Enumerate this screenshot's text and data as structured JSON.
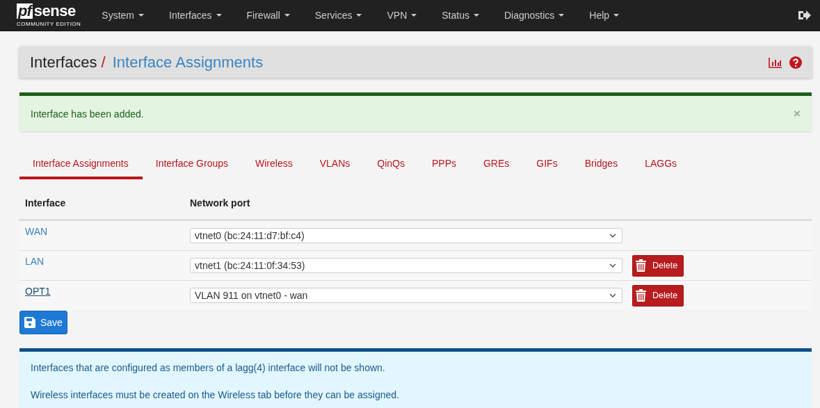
{
  "navbar": {
    "logo": {
      "mark": "pf",
      "word": "sense",
      "edition": "COMMUNITY EDITION"
    },
    "menus": [
      {
        "label": "System"
      },
      {
        "label": "Interfaces"
      },
      {
        "label": "Firewall"
      },
      {
        "label": "Services"
      },
      {
        "label": "VPN"
      },
      {
        "label": "Status"
      },
      {
        "label": "Diagnostics"
      },
      {
        "label": "Help"
      }
    ]
  },
  "page_header": {
    "section": "Interfaces",
    "separator": "/",
    "title": "Interface Assignments"
  },
  "alert": {
    "kind": "success",
    "message": "Interface has been added.",
    "close": "×"
  },
  "tabs": [
    {
      "label": "Interface Assignments",
      "selected": true
    },
    {
      "label": "Interface Groups",
      "selected": false
    },
    {
      "label": "Wireless",
      "selected": false
    },
    {
      "label": "VLANs",
      "selected": false
    },
    {
      "label": "QinQs",
      "selected": false
    },
    {
      "label": "PPPs",
      "selected": false
    },
    {
      "label": "GREs",
      "selected": false
    },
    {
      "label": "GIFs",
      "selected": false
    },
    {
      "label": "Bridges",
      "selected": false
    },
    {
      "label": "LAGGs",
      "selected": false
    }
  ],
  "table": {
    "columns": [
      "Interface",
      "Network port"
    ],
    "rows": [
      {
        "interface": "WAN",
        "port": "vtnet0 (bc:24:11:d7:bf:c4)",
        "hovered": false,
        "deletable": false
      },
      {
        "interface": "LAN",
        "port": "vtnet1 (bc:24:11:0f:34:53)",
        "hovered": false,
        "deletable": true,
        "delete_label": "Delete"
      },
      {
        "interface": "OPT1",
        "port": "VLAN 911 on vtnet0 - wan",
        "hovered": true,
        "deletable": true,
        "delete_label": "Delete"
      }
    ]
  },
  "save_button": {
    "label": "Save"
  },
  "info": {
    "kind": "info",
    "lines": [
      "Interfaces that are configured as members of a lagg(4) interface will not be shown.",
      "Wireless interfaces must be created on the Wireless tab before they can be assigned."
    ]
  }
}
